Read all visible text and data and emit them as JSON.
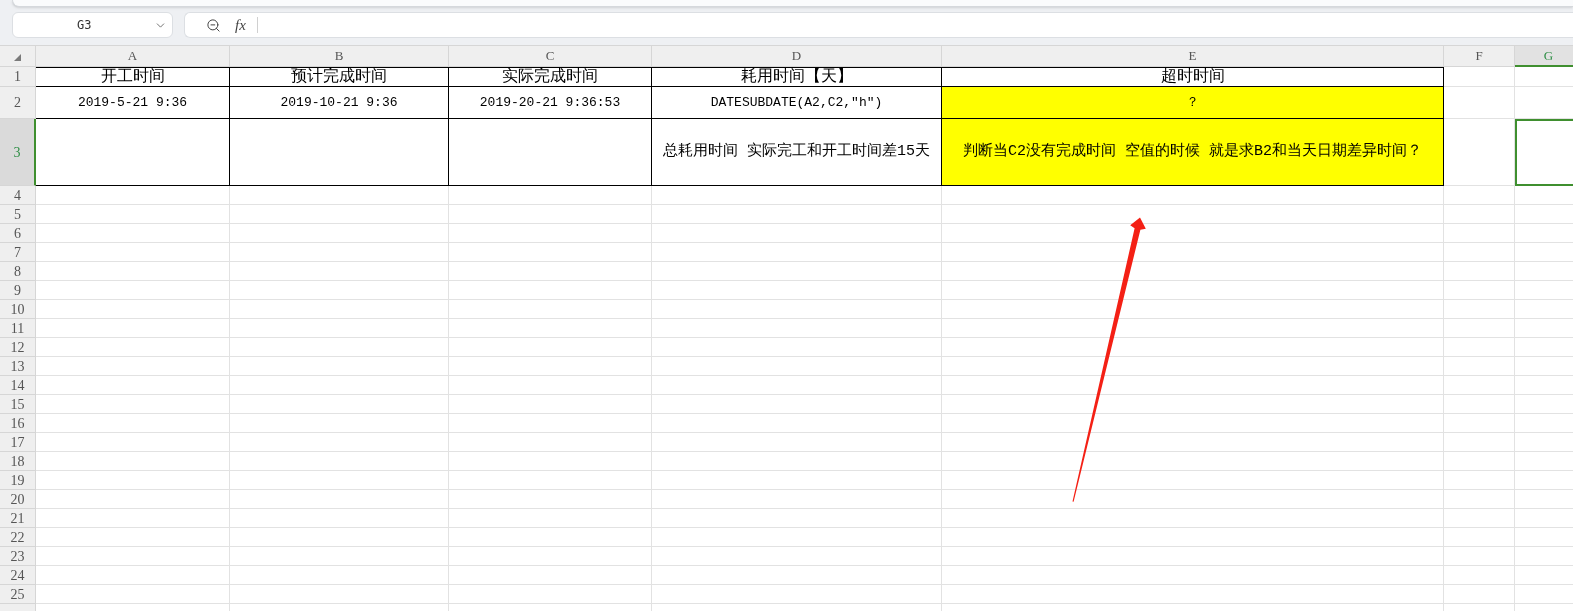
{
  "name_box": {
    "value": "G3"
  },
  "formula_bar": {
    "function_label": "fx"
  },
  "columns": [
    {
      "label": "A",
      "selected": false
    },
    {
      "label": "B",
      "selected": false
    },
    {
      "label": "C",
      "selected": false
    },
    {
      "label": "D",
      "selected": false
    },
    {
      "label": "E",
      "selected": false
    },
    {
      "label": "F",
      "selected": false
    },
    {
      "label": "G",
      "selected": true
    }
  ],
  "rows": [
    {
      "label": "1",
      "selected": false,
      "cells": [
        {
          "text": "开工时间",
          "bordered": true
        },
        {
          "text": "预计完成时间",
          "bordered": true
        },
        {
          "text": "实际完成时间",
          "bordered": true
        },
        {
          "text": "耗用时间【天】",
          "bordered": true
        },
        {
          "text": "超时时间",
          "bordered": true
        }
      ]
    },
    {
      "label": "2",
      "selected": false,
      "cells": [
        {
          "text": "2019-5-21 9:36",
          "bordered": true
        },
        {
          "text": "2019-10-21 9:36",
          "bordered": true
        },
        {
          "text": "2019-20-21 9:36:53",
          "bordered": true
        },
        {
          "text": "DATESUBDATE(A2,C2,\"h\")",
          "bordered": true
        },
        {
          "text": "？",
          "bordered": true,
          "color": "#ffff00"
        }
      ]
    },
    {
      "label": "3",
      "selected": true,
      "cells": [
        {
          "bordered": true
        },
        {
          "bordered": true
        },
        {
          "bordered": true
        },
        {
          "text": "总耗用时间 实际完工和开工时间差15天",
          "bordered": true
        },
        {
          "text": "判断当C2没有完成时间 空值的时候 就是求B2和当天日期差异时间？",
          "bordered": true,
          "color": "#ffff00"
        }
      ]
    },
    {
      "label": "4",
      "selected": false
    },
    {
      "label": "5",
      "selected": false
    },
    {
      "label": "6",
      "selected": false
    },
    {
      "label": "7",
      "selected": false
    },
    {
      "label": "8",
      "selected": false
    },
    {
      "label": "9",
      "selected": false
    },
    {
      "label": "10",
      "selected": false
    },
    {
      "label": "11",
      "selected": false
    },
    {
      "label": "12",
      "selected": false
    },
    {
      "label": "13",
      "selected": false
    },
    {
      "label": "14",
      "selected": false
    },
    {
      "label": "15",
      "selected": false
    },
    {
      "label": "16",
      "selected": false
    },
    {
      "label": "17",
      "selected": false
    },
    {
      "label": "18",
      "selected": false
    },
    {
      "label": "19",
      "selected": false
    },
    {
      "label": "20",
      "selected": false
    },
    {
      "label": "21",
      "selected": false
    },
    {
      "label": "22",
      "selected": false
    },
    {
      "label": "23",
      "selected": false
    },
    {
      "label": "24",
      "selected": false
    },
    {
      "label": "25",
      "selected": false
    }
  ]
}
